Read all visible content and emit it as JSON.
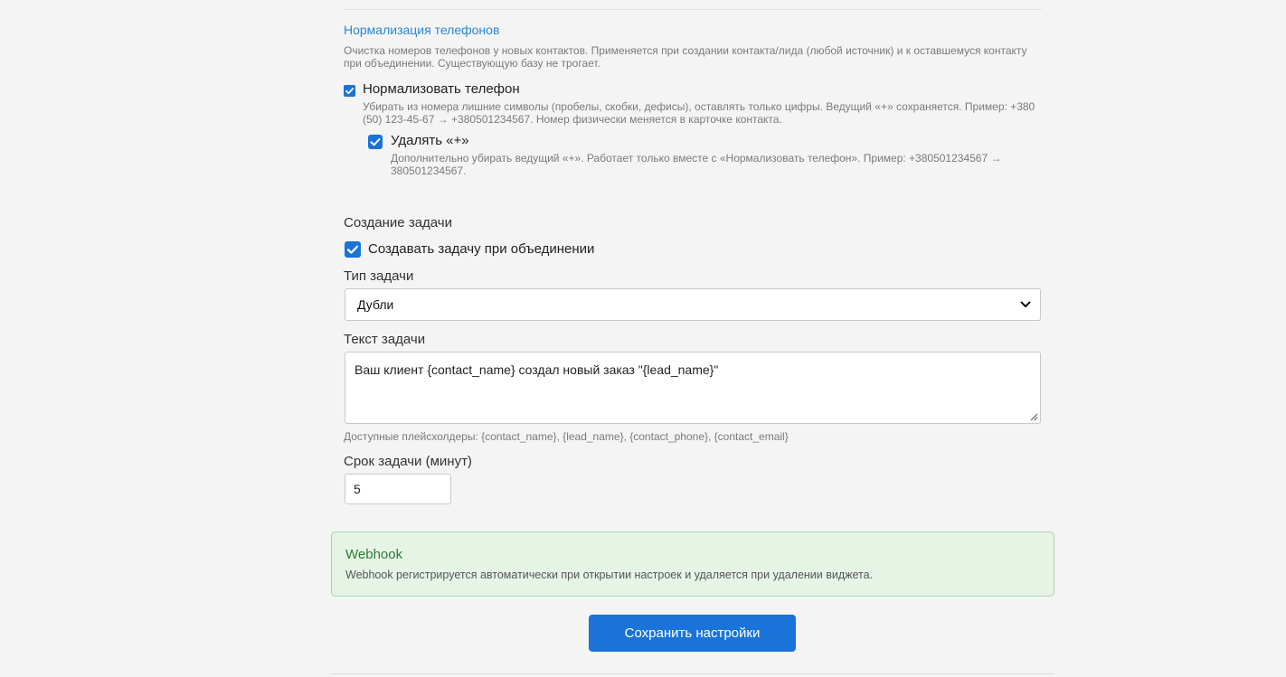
{
  "phone_normalization": {
    "title": "Нормализация телефонов",
    "description": "Очистка номеров телефонов у новых контактов. Применяется при создании контакта/лида (любой источник) и к оставшемуся контакту при объединении. Существующую базу не трогает.",
    "normalize_option": {
      "label": "Нормализовать телефон",
      "checked": true,
      "hint": "Убирать из номера лишние символы (пробелы, скобки, дефисы), оставлять только цифры. Ведущий «+» сохраняется. Пример: +380 (50) 123-45-67 → +380501234567. Номер физически меняется в карточке контакта."
    },
    "remove_plus_option": {
      "label": "Удалять «+»",
      "checked": true,
      "hint": "Дополнительно убирать ведущий «+». Работает только вместе с «Нормализовать телефон». Пример: +380501234567 → 380501234567."
    }
  },
  "task_creation": {
    "title": "Создание задачи",
    "create_on_merge": {
      "label": "Создавать задачу при объединении",
      "checked": true
    },
    "task_type": {
      "label": "Тип задачи",
      "value": "Дубли"
    },
    "task_text": {
      "label": "Текст задачи",
      "value": "Ваш клиент {contact_name} создал новый заказ \"{lead_name}\"",
      "placeholders_hint": "Доступные плейсхолдеры: {contact_name}, {lead_name}, {contact_phone}, {contact_email}"
    },
    "task_deadline": {
      "label": "Срок задачи (минут)",
      "value": "5"
    }
  },
  "webhook": {
    "title": "Webhook",
    "text": "Webhook регистрируется автоматически при открытии настроек и удаляется при удалении виджета."
  },
  "save_button_label": "Сохранить настройки",
  "colors": {
    "accent": "#1a73d9",
    "link_title": "#2a86d6",
    "success_bg": "#e6f4e6",
    "success_border": "#a8d6a8",
    "success_text": "#2e7d32"
  }
}
